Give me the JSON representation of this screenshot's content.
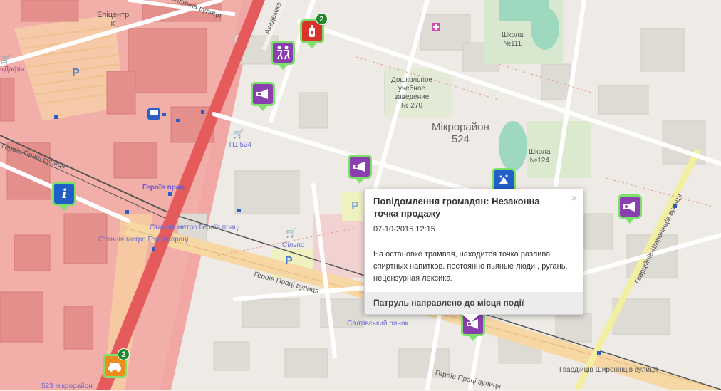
{
  "map": {
    "labels": {
      "epicentr": "Епіцентр\nК",
      "teplychna": "Теплична вулиця",
      "akademika": "Академіка",
      "dafi": "«Дафі»",
      "school111": "Школа\n№111",
      "preschool": "Дошкольное\nучебное\nзаведение\n№ 270",
      "mikroraion": "Мікрорайон\n524",
      "school124": "Школа\n№124",
      "tc524": "ТЦ 524",
      "heroiv_pratsi_street_left": "Героїв Праці вулиця",
      "heroiv_pratsi_metro": "Героїв праці",
      "stantsiia_1": "Станція метро Героїв праці",
      "stantsiia_2": "Станція метро Героїв праці",
      "silpo": "Сільпо",
      "heroiv_pratsi_street_mid": "Героїв Праці вулиця",
      "saltivskyi_rynok": "Салтівський ринок",
      "heroiv_pratsi_street_bottom": "Героїв Праці вулиця",
      "gvardiitsiv_v": "Гвардійців-Широнінців вулиця",
      "gvardiitsiv_h": "Гвардійців Широнінців вулиця",
      "mkr_523": "523 мікрорайон",
      "parking": "P"
    },
    "markers": [
      {
        "name": "alcohol-marker-1"
      },
      {
        "name": "red-marker",
        "badge": "2"
      },
      {
        "name": "dance-marker"
      },
      {
        "name": "info-marker"
      },
      {
        "name": "taxi-marker",
        "badge": "2"
      }
    ],
    "colors": {
      "purple": "#8a3fb0",
      "green_halo": "#7ee06a",
      "red_zone": "#f2a6a6",
      "road_yellow": "#f7d9a6"
    }
  },
  "popup": {
    "title": "Повідомлення громадян: Незаконна точка продажу",
    "date": "07-10-2015 12:15",
    "body": "На остановке трамвая, находится точка разлива спиртных напитков. постоянно пьяные люди , ругань, нецензурная лексика.",
    "footer": "Патруль направлено до місця події",
    "close": "×"
  }
}
